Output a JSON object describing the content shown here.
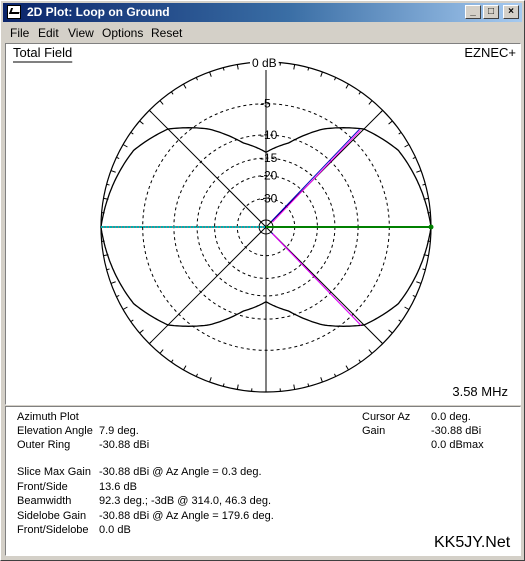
{
  "window": {
    "title": "2D Plot: Loop on Ground",
    "minimize_label": "_",
    "maximize_label": "□",
    "close_label": "×"
  },
  "menu": [
    {
      "label": "File"
    },
    {
      "label": "Edit"
    },
    {
      "label": "View"
    },
    {
      "label": "Options"
    },
    {
      "label": "Reset"
    }
  ],
  "plot": {
    "field_label": "Total Field",
    "brand": "EZNEC+",
    "frequency": "3.58 MHz",
    "ring_labels": [
      "0 dB",
      "-5",
      "-10",
      "-15",
      "-20",
      "-30"
    ],
    "colors": {
      "pattern": "#000000",
      "cursor_left": "#00b0b0",
      "cursor_right": "#008000",
      "diag_beam": "#ff00ff",
      "diag_beam_2": "#0000c0"
    }
  },
  "info": {
    "left": [
      {
        "label": "Azimuth Plot",
        "value": ""
      },
      {
        "label": "Elevation Angle",
        "value": "7.9 deg."
      },
      {
        "label": "Outer Ring",
        "value": "-30.88 dBi"
      },
      {
        "label": "Slice Max Gain",
        "value": "-30.88 dBi @ Az Angle = 0.3 deg."
      },
      {
        "label": "Front/Side",
        "value": "13.6 dB"
      },
      {
        "label": "Beamwidth",
        "value": "92.3 deg.; -3dB @ 314.0, 46.3 deg."
      },
      {
        "label": "Sidelobe Gain",
        "value": "-30.88 dBi @ Az Angle = 179.6 deg."
      },
      {
        "label": "Front/Sidelobe",
        "value": "0.0 dB"
      }
    ],
    "cursor_az_label": "Cursor Az",
    "cursor_az_value": "0.0 deg.",
    "gain_label": "Gain",
    "gain_value": "-30.88 dBi",
    "gain_value_2": "0.0 dBmax",
    "watermark": "KK5JY.Net"
  },
  "chart_data": {
    "type": "polar",
    "title": "Total Field",
    "plot_type": "Azimuth Plot",
    "ring_labels_db": [
      0,
      -5,
      -10,
      -15,
      -20,
      -30
    ],
    "pattern_db_approx": {
      "description_free": true,
      "az_deg": [
        0,
        30,
        45,
        60,
        75,
        90,
        105,
        120,
        135,
        150,
        180,
        210,
        225,
        240,
        255,
        270,
        285,
        300,
        315,
        330
      ],
      "gain_db": [
        0,
        -1.3,
        -3.0,
        -6.5,
        -11,
        -13.6,
        -11,
        -6.5,
        -3.0,
        -1.3,
        0,
        -1.3,
        -3.0,
        -6.5,
        -11,
        -13.6,
        -11,
        -6.5,
        -3.0,
        -1.3
      ]
    }
  }
}
